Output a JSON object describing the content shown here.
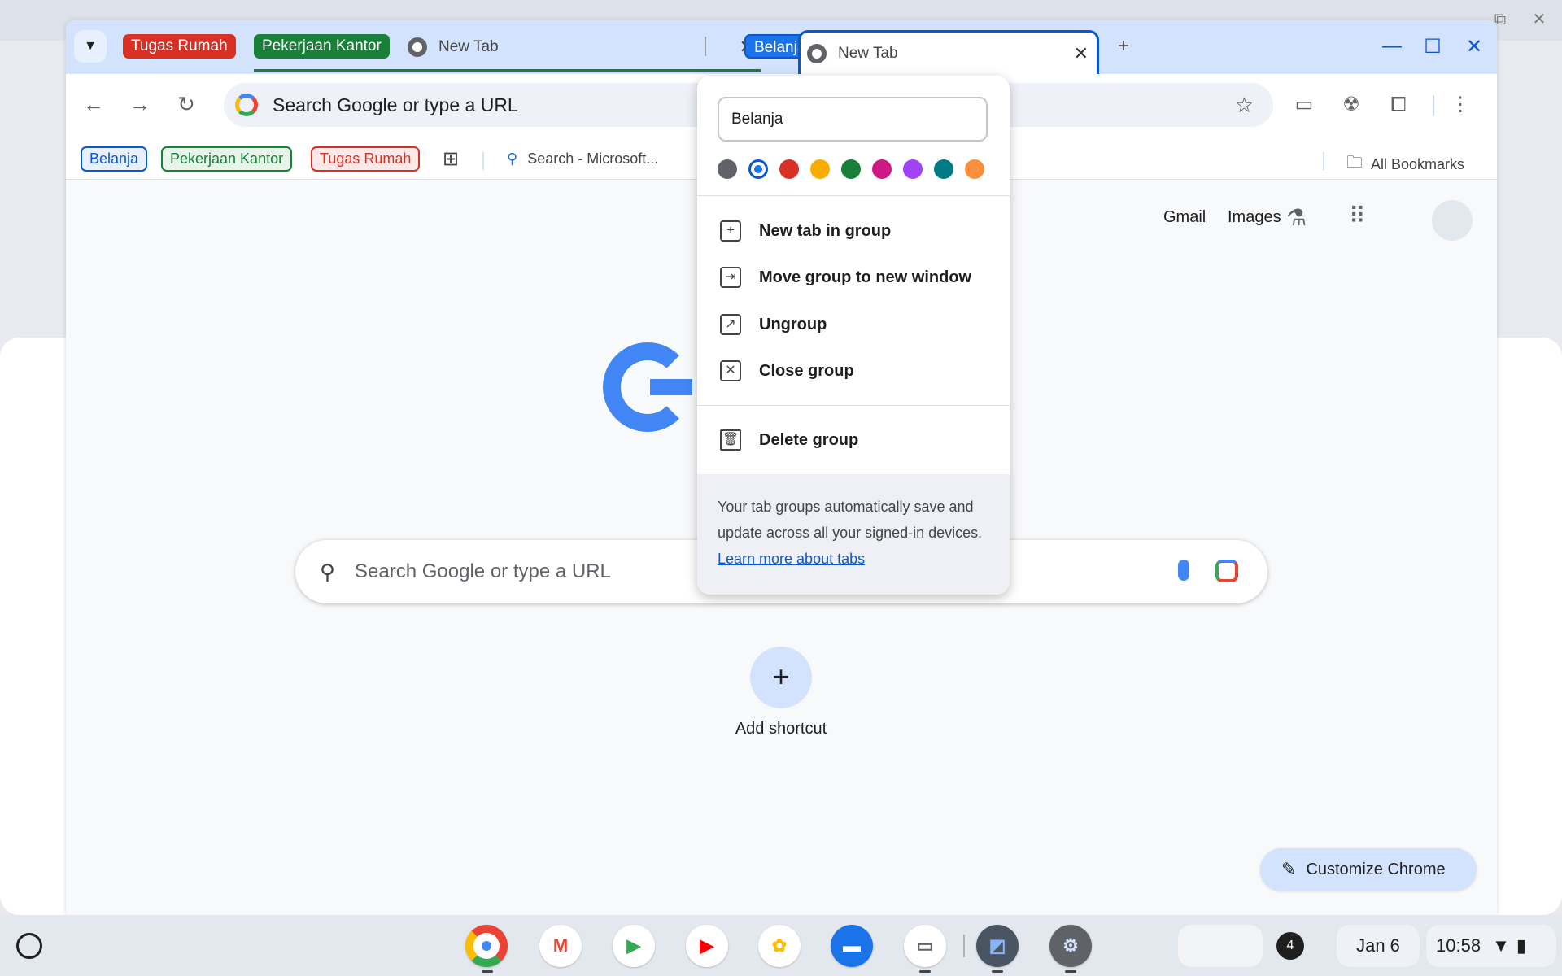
{
  "tabstrip": {
    "groups": [
      {
        "label": "Tugas Rumah",
        "color": "#d93025"
      },
      {
        "label": "Pekerjaan Kantor",
        "color": "#188038"
      },
      {
        "label": "Belanja",
        "color": "#1a73e8"
      }
    ],
    "tabs": [
      {
        "title": "New Tab"
      },
      {
        "title": "New Tab"
      }
    ]
  },
  "toolbar": {
    "omnibox_placeholder": "Search Google or type a URL"
  },
  "bookmarks": {
    "chips": [
      {
        "label": "Belanja",
        "color": "#0b57d0"
      },
      {
        "label": "Pekerjaan Kantor",
        "color": "#188038"
      },
      {
        "label": "Tugas Rumah",
        "color": "#d93025"
      }
    ],
    "search_item": "Search - Microsoft...",
    "all_bookmarks": "All Bookmarks"
  },
  "ntp": {
    "links": [
      "Gmail",
      "Images"
    ],
    "search_placeholder": "Search Google or type a URL",
    "add_shortcut": "Add shortcut",
    "customize": "Customize Chrome"
  },
  "group_menu": {
    "name_value": "Belanja",
    "colors": [
      "#5f6368",
      "#1a73e8",
      "#d93025",
      "#f9ab00",
      "#188038",
      "#d01884",
      "#a142f4",
      "#007b83",
      "#fa903e"
    ],
    "selected_color": "#1a73e8",
    "items": [
      {
        "label": "New tab in group",
        "icon": "new-tab-in-group-icon"
      },
      {
        "label": "Move group to new window",
        "icon": "move-window-icon"
      },
      {
        "label": "Ungroup",
        "icon": "ungroup-icon"
      },
      {
        "label": "Close group",
        "icon": "close-group-icon"
      },
      {
        "label": "Delete group",
        "icon": "trash-icon"
      }
    ],
    "footer_text": "Your tab groups automatically save and update across all your signed-in devices.",
    "footer_link": "Learn more about tabs"
  },
  "shelf": {
    "notification_count": "4",
    "date": "Jan 6",
    "time": "10:58"
  }
}
